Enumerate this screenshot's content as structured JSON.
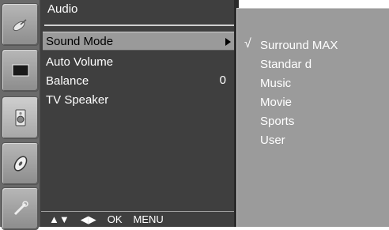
{
  "panel": {
    "title": "Audio",
    "items": [
      {
        "label": "Sound Mode",
        "value": "",
        "selected": true
      },
      {
        "label": "Auto Volume",
        "value": ""
      },
      {
        "label": "Balance",
        "value": "0"
      },
      {
        "label": "TV Speaker",
        "value": ""
      }
    ]
  },
  "footer": {
    "nav_updown": "▲▼",
    "nav_leftright": "◀▶",
    "ok": "OK",
    "menu": "MENU"
  },
  "submenu": {
    "check": "√",
    "items": [
      "Surround MAX",
      "Standar d",
      "Music",
      "Movie",
      "Sports",
      "User"
    ],
    "checked_index": 0
  },
  "rail": {
    "icons": [
      "satellite-dish-icon",
      "monitor-icon",
      "speaker-icon",
      "disc-icon",
      "wrench-icon"
    ],
    "active_index": 2
  }
}
